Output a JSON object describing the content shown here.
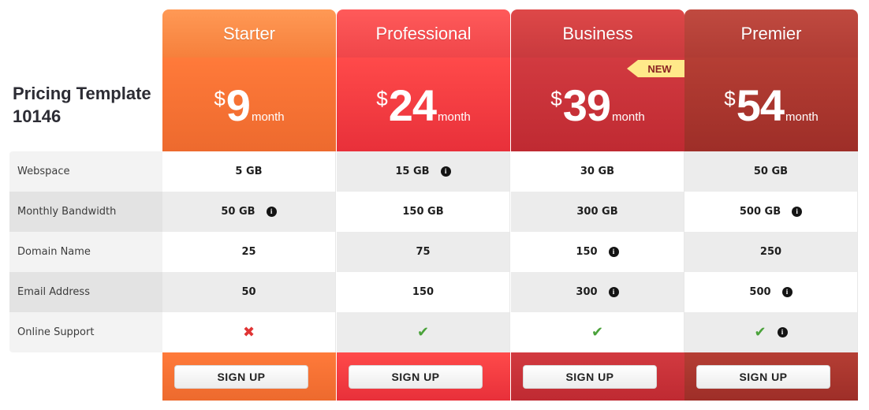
{
  "page": {
    "title": "Pricing Template 10146"
  },
  "features": [
    "Webspace",
    "Monthly Bandwidth",
    "Domain Name",
    "Email Address",
    "Online Support"
  ],
  "plans": [
    {
      "name": "Starter",
      "currency": "$",
      "amount": "9",
      "period": "month",
      "badge": "",
      "values": [
        "5 GB",
        "50 GB",
        "25",
        "50",
        ""
      ],
      "info": [
        false,
        true,
        false,
        false,
        false
      ],
      "support": "cross-icon",
      "signup": "SIGN UP"
    },
    {
      "name": "Professional",
      "currency": "$",
      "amount": "24",
      "period": "month",
      "badge": "",
      "values": [
        "15 GB",
        "150 GB",
        "75",
        "150",
        ""
      ],
      "info": [
        true,
        false,
        false,
        false,
        false
      ],
      "support": "check-icon",
      "signup": "SIGN UP"
    },
    {
      "name": "Business",
      "currency": "$",
      "amount": "39",
      "period": "month",
      "badge": "NEW",
      "values": [
        "30 GB",
        "300 GB",
        "150",
        "300",
        ""
      ],
      "info": [
        false,
        false,
        true,
        true,
        false
      ],
      "support": "check-icon",
      "signup": "SIGN UP"
    },
    {
      "name": "Premier",
      "currency": "$",
      "amount": "54",
      "period": "month",
      "badge": "",
      "values": [
        "50 GB",
        "500 GB",
        "250",
        "500",
        ""
      ],
      "info": [
        false,
        true,
        false,
        true,
        true
      ],
      "support": "check-icon",
      "signup": "SIGN UP"
    }
  ],
  "icons": {
    "info": "info-icon",
    "check": "check-icon",
    "cross": "cross-icon"
  }
}
